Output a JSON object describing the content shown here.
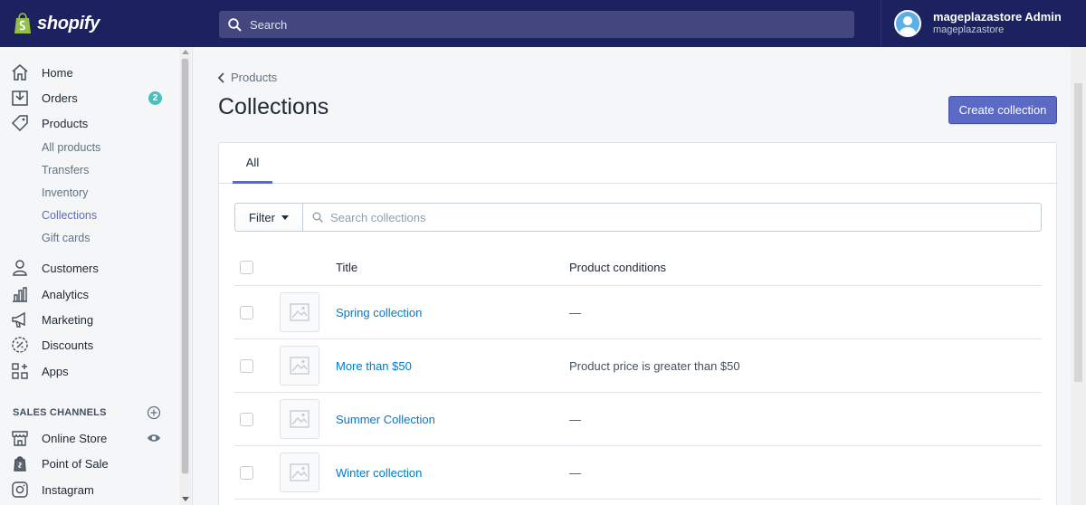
{
  "topbar": {
    "brand": "shopify",
    "search_placeholder": "Search",
    "account_name": "mageplazastore Admin",
    "account_store": "mageplazastore"
  },
  "sidebar": {
    "items": [
      {
        "label": "Home",
        "icon": "home-icon"
      },
      {
        "label": "Orders",
        "icon": "orders-icon",
        "badge": "2"
      },
      {
        "label": "Products",
        "icon": "tag-icon"
      },
      {
        "label": "Customers",
        "icon": "person-icon"
      },
      {
        "label": "Analytics",
        "icon": "bar-chart-icon"
      },
      {
        "label": "Marketing",
        "icon": "megaphone-icon"
      },
      {
        "label": "Discounts",
        "icon": "discount-icon"
      },
      {
        "label": "Apps",
        "icon": "apps-icon"
      }
    ],
    "product_subitems": [
      "All products",
      "Transfers",
      "Inventory",
      "Collections",
      "Gift cards"
    ],
    "active_subitem": "Collections",
    "sales_channels_heading": "SALES CHANNELS",
    "channels": [
      {
        "label": "Online Store",
        "icon": "store-icon"
      },
      {
        "label": "Point of Sale",
        "icon": "pos-icon"
      },
      {
        "label": "Instagram",
        "icon": "instagram-icon"
      }
    ]
  },
  "main": {
    "breadcrumb": "Products",
    "title": "Collections",
    "create_button": "Create collection",
    "tabs": [
      "All"
    ],
    "filter_label": "Filter",
    "search_placeholder": "Search collections",
    "columns": [
      "Title",
      "Product conditions"
    ],
    "rows": [
      {
        "title": "Spring collection",
        "conditions": "—"
      },
      {
        "title": "More than $50",
        "conditions": "Product price is greater than $50"
      },
      {
        "title": "Summer Collection",
        "conditions": "—"
      },
      {
        "title": "Winter collection",
        "conditions": "—"
      }
    ]
  },
  "colors": {
    "topbar": "#1c2260",
    "primary": "#5c6ac4",
    "link": "#007ace",
    "badge": "#47c1bf"
  }
}
